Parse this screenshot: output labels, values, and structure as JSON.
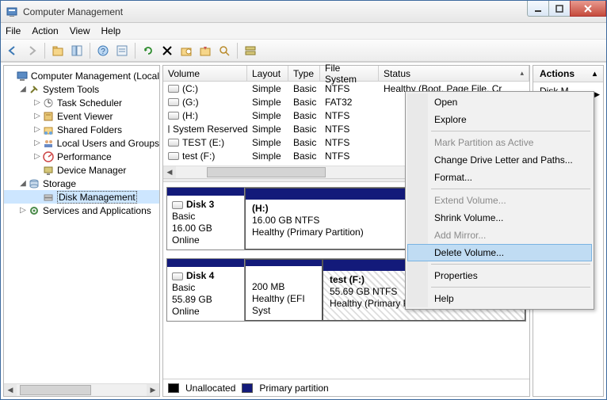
{
  "window": {
    "title": "Computer Management"
  },
  "menu": {
    "file": "File",
    "action": "Action",
    "view": "View",
    "help": "Help"
  },
  "tree": {
    "root": "Computer Management (Local",
    "system_tools": "System Tools",
    "task_scheduler": "Task Scheduler",
    "event_viewer": "Event Viewer",
    "shared_folders": "Shared Folders",
    "local_users": "Local Users and Groups",
    "performance": "Performance",
    "device_manager": "Device Manager",
    "storage": "Storage",
    "disk_mgmt": "Disk Management",
    "services": "Services and Applications"
  },
  "columns": {
    "volume": "Volume",
    "layout": "Layout",
    "type": "Type",
    "fs": "File System",
    "status": "Status"
  },
  "volumes": [
    {
      "name": "(C:)",
      "layout": "Simple",
      "type": "Basic",
      "fs": "NTFS",
      "status": "Healthy (Boot, Page File, Cr"
    },
    {
      "name": "(G:)",
      "layout": "Simple",
      "type": "Basic",
      "fs": "FAT32",
      "status": ""
    },
    {
      "name": "(H:)",
      "layout": "Simple",
      "type": "Basic",
      "fs": "NTFS",
      "status": ""
    },
    {
      "name": "System Reserved",
      "layout": "Simple",
      "type": "Basic",
      "fs": "NTFS",
      "status": ""
    },
    {
      "name": "TEST (E:)",
      "layout": "Simple",
      "type": "Basic",
      "fs": "NTFS",
      "status": ""
    },
    {
      "name": "test (F:)",
      "layout": "Simple",
      "type": "Basic",
      "fs": "NTFS",
      "status": ""
    }
  ],
  "disk3": {
    "label": "Disk 3",
    "kind": "Basic",
    "size": "16.00 GB",
    "state": "Online",
    "vol_name": "(H:)",
    "vol_size": "16.00 GB NTFS",
    "vol_status": "Healthy (Primary Partition)"
  },
  "disk4": {
    "label": "Disk 4",
    "kind": "Basic",
    "size": "55.89 GB",
    "state": "Online",
    "v1_size": "200 MB",
    "v1_status": "Healthy (EFI Syst",
    "v2_name": "test  (F:)",
    "v2_size": "55.69 GB NTFS",
    "v2_status": "Healthy (Primary Partition)"
  },
  "legend": {
    "unalloc": "Unallocated",
    "primary": "Primary partition"
  },
  "actions": {
    "title": "Actions",
    "sub": "Disk M…"
  },
  "ctx": {
    "open": "Open",
    "explore": "Explore",
    "mark_active": "Mark Partition as Active",
    "change_letter": "Change Drive Letter and Paths...",
    "format": "Format...",
    "extend": "Extend Volume...",
    "shrink": "Shrink Volume...",
    "add_mirror": "Add Mirror...",
    "delete": "Delete Volume...",
    "properties": "Properties",
    "help": "Help"
  }
}
